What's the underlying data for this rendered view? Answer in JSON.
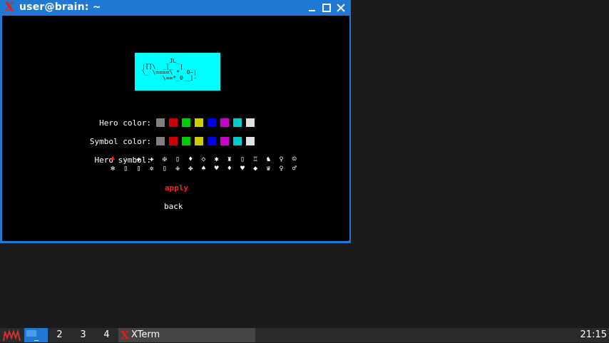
{
  "window": {
    "title": "user@brain: ~",
    "icon": "xterm-x-icon",
    "buttons": [
      "minimize-icon",
      "maximize-icon",
      "close-icon"
    ]
  },
  "terminal": {
    "preview_bg": "#00ffff",
    "preview_art": " __    _JL_\n|[]\\  _|_  |\n\\_ \\====\\ *  0~|\n      \\==*_0__]-",
    "hero_color_label": "Hero color:",
    "symbol_color_label": "Symbol color:",
    "hero_symbol_label": "Hero symbol:",
    "colors": [
      "#808080",
      "#cc0000",
      "#00cc00",
      "#cccc00",
      "#0000ee",
      "#cc00cc",
      "#00cccc",
      "#e0e0e0"
    ],
    "symbols_row1": [
      "♣",
      "♘",
      "✚",
      "✚",
      "✠",
      "▯",
      "♦",
      "◇",
      "✱",
      "♜",
      "▯",
      "♖",
      "♞",
      "♀",
      "☺"
    ],
    "symbols_row2": [
      "✻",
      "▯",
      "▯",
      "✲",
      "▯",
      "✙",
      "✤",
      "♠",
      "♥",
      "♦",
      "♥",
      "◆",
      "♛",
      "♀",
      "♂"
    ],
    "selected_symbol_color": "#ff2020",
    "apply_label": "apply",
    "back_label": "back"
  },
  "taskbar": {
    "workspaces": [
      "_",
      "2",
      "3",
      "4"
    ],
    "task_label": "XTerm",
    "clock": "21:15"
  }
}
